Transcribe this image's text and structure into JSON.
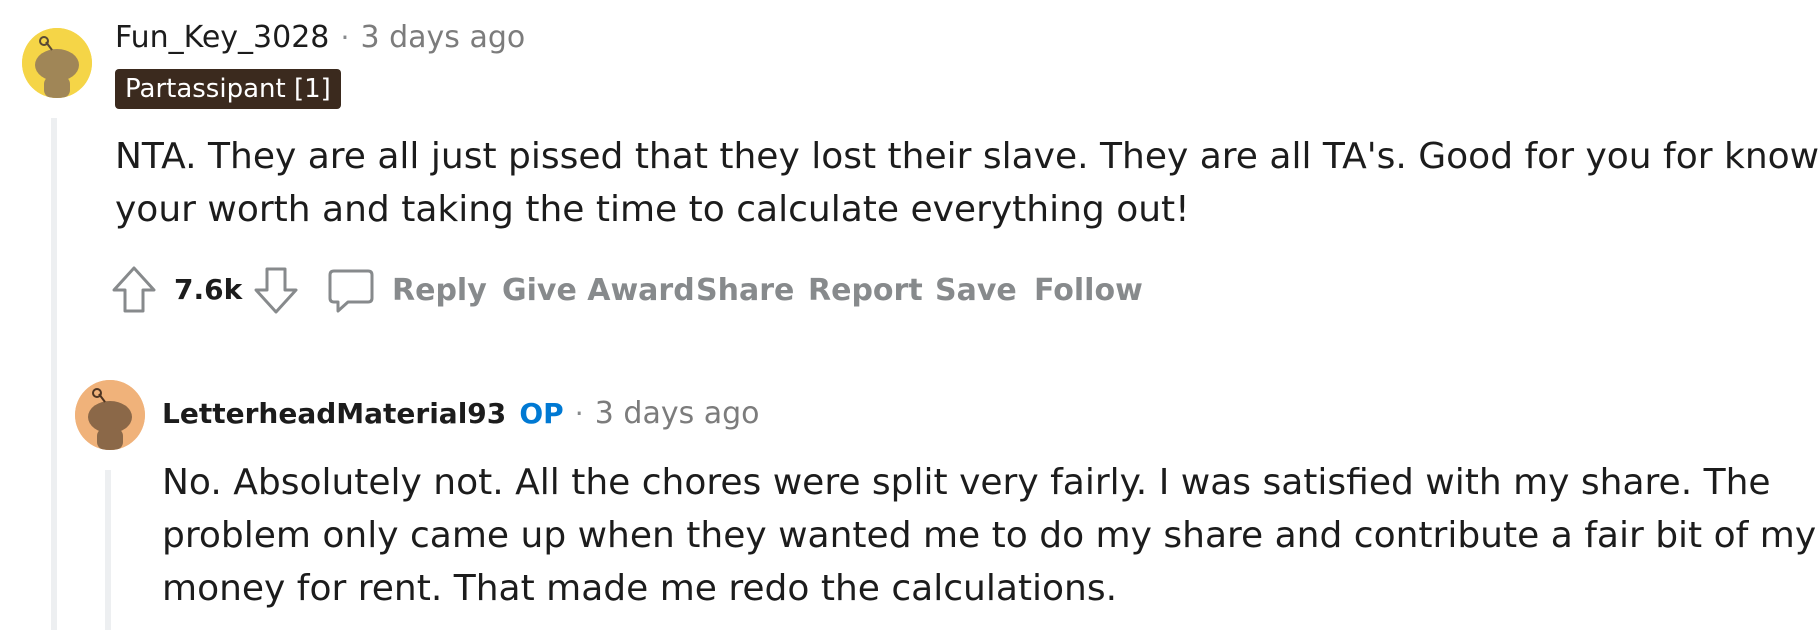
{
  "comment": {
    "username": "Fun_Key_3028",
    "separator": "·",
    "time": "3 days ago",
    "flair": "Partassipant [1]",
    "body_line1": "NTA. They are all just pissed that they lost their slave. They are all TA's. Good for you for knowing",
    "body_line2": "your worth and taking the time to calculate everything out!",
    "score": "7.6k",
    "actions": {
      "reply": "Reply",
      "give_award": "Give Award",
      "share": "Share",
      "report": "Report",
      "save": "Save",
      "follow": "Follow"
    },
    "avatar_color": "#f5d547"
  },
  "reply": {
    "username": "LetterheadMaterial93",
    "op_badge": "OP",
    "separator": "·",
    "time": "3 days ago",
    "body_line1": "No. Absolutely not. All the chores were split very fairly. I was satisfied with my share. The",
    "body_line2": "problem only came up when they wanted me to do my share and contribute a fair bit of my",
    "body_line3": "money for rent. That made me redo the calculations.",
    "avatar_color": "#f0b27a"
  },
  "colors": {
    "action_gray": "#878a8c",
    "op_blue": "#0079d3",
    "flair_bg": "#3b2a1e",
    "thread_line": "#edeff1"
  }
}
